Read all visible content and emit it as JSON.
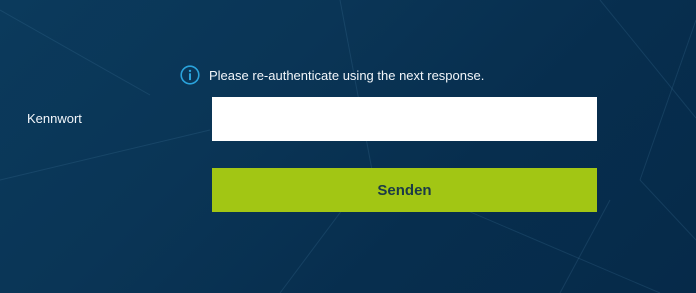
{
  "colors": {
    "background": "#0a3556",
    "accent": "#a2c614",
    "info_icon": "#2aa3dc",
    "button_text": "#1c3a47"
  },
  "notice": {
    "icon": "info-icon",
    "text": "Please re-authenticate using the next response."
  },
  "form": {
    "password_label": "Kennwort",
    "password_value": "",
    "password_placeholder": "",
    "submit_label": "Senden"
  }
}
